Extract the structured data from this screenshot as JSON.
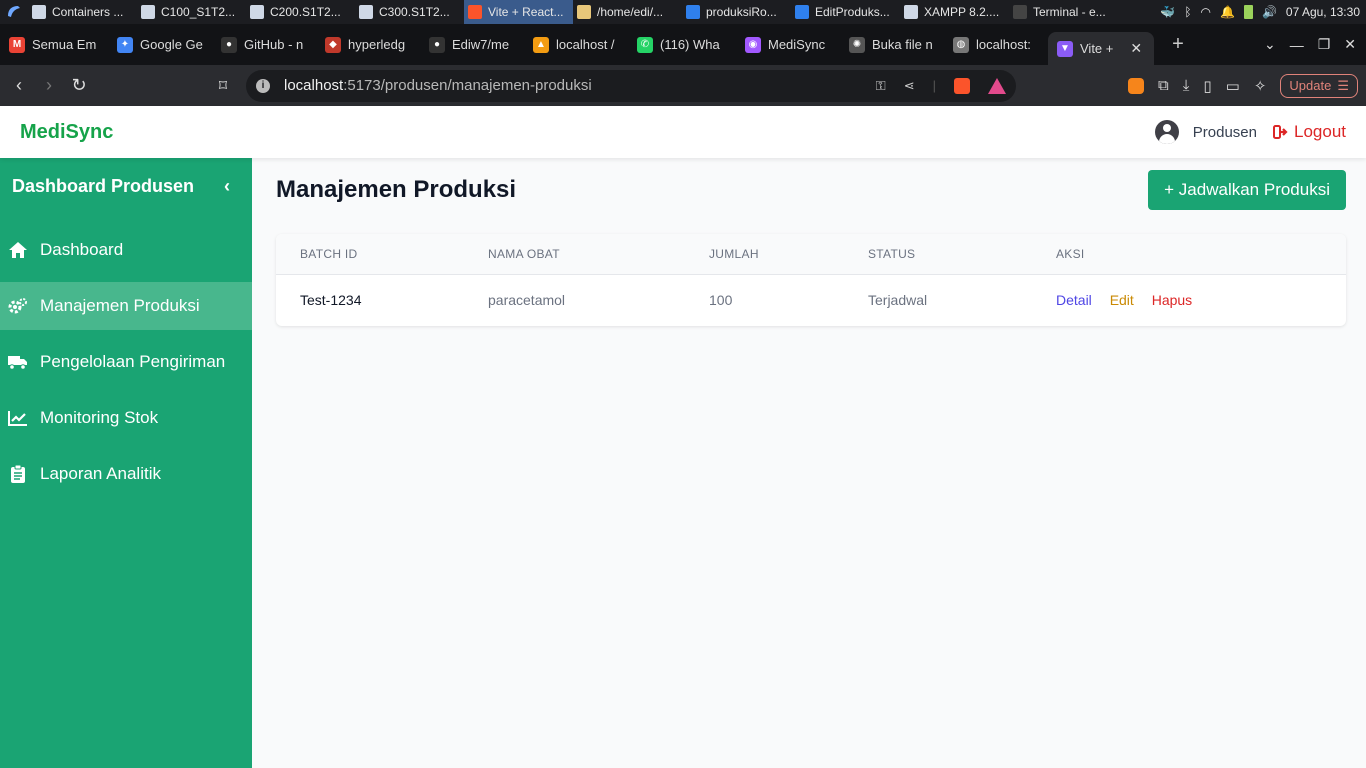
{
  "taskbar": {
    "tasks": [
      {
        "label": "Containers ...",
        "icon": "window-icon",
        "color": "#cfd8e6"
      },
      {
        "label": "C100_S1T2...",
        "icon": "document-icon",
        "color": "#cfd8e6"
      },
      {
        "label": "C200.S1T2...",
        "icon": "document-icon",
        "color": "#cfd8e6"
      },
      {
        "label": "C300.S1T2...",
        "icon": "document-icon",
        "color": "#cfd8e6"
      },
      {
        "label": "Vite + React...",
        "icon": "brave-icon",
        "color": "#fb542b"
      },
      {
        "label": "/home/edi/...",
        "icon": "folder-icon",
        "color": "#e8c77a"
      },
      {
        "label": "produksiRo...",
        "icon": "vscode-icon",
        "color": "#2f80ed"
      },
      {
        "label": "EditProduks...",
        "icon": "vscode-icon",
        "color": "#2f80ed"
      },
      {
        "label": "XAMPP 8.2....",
        "icon": "window-icon",
        "color": "#cfd8e6"
      },
      {
        "label": "Terminal - e...",
        "icon": "terminal-icon",
        "color": "#444444"
      }
    ],
    "clock": "07 Agu, 13:30"
  },
  "browser_tabs": [
    {
      "label": "Semua Em",
      "favicon": "gmail-icon",
      "color": "#ea4335",
      "glyph": "M"
    },
    {
      "label": "Google Ge",
      "favicon": "gemini-icon",
      "color": "#4285f4",
      "glyph": "✦"
    },
    {
      "label": "GitHub - n",
      "favicon": "github-icon",
      "color": "#333333",
      "glyph": "●"
    },
    {
      "label": "hyperledg",
      "favicon": "shield-icon",
      "color": "#c0392b",
      "glyph": "◆"
    },
    {
      "label": "Ediw7/me",
      "favicon": "github-icon",
      "color": "#333333",
      "glyph": "●"
    },
    {
      "label": "localhost /",
      "favicon": "phpmyadmin-icon",
      "color": "#f39c12",
      "glyph": "▲"
    },
    {
      "label": "(116) Wha",
      "favicon": "whatsapp-icon",
      "color": "#25d366",
      "glyph": "✆"
    },
    {
      "label": "MediSync",
      "favicon": "figma-icon",
      "color": "#a259ff",
      "glyph": "◉"
    },
    {
      "label": "Buka file n",
      "favicon": "openai-icon",
      "color": "#555555",
      "glyph": "✺"
    },
    {
      "label": "localhost:",
      "favicon": "globe-icon",
      "color": "#777777",
      "glyph": "◍"
    },
    {
      "label": "Vite +",
      "favicon": "vite-icon",
      "color": "#8b5cf6",
      "glyph": "▼"
    }
  ],
  "address": {
    "host": "localhost",
    "path": ":5173/produsen/manajemen-produksi",
    "update_label": "Update"
  },
  "app": {
    "brand": "MediSync",
    "user_label": "Produsen",
    "logout_label": "Logout",
    "accent": "#1aa473"
  },
  "sidebar": {
    "title": "Dashboard Produsen",
    "items": [
      {
        "label": "Dashboard",
        "icon": "home-icon",
        "active": false
      },
      {
        "label": "Manajemen Produksi",
        "icon": "cogs-icon",
        "active": true
      },
      {
        "label": "Pengelolaan Pengiriman",
        "icon": "truck-icon",
        "active": false
      },
      {
        "label": "Monitoring Stok",
        "icon": "chart-line-icon",
        "active": false
      },
      {
        "label": "Laporan Analitik",
        "icon": "clipboard-icon",
        "active": false
      }
    ]
  },
  "main": {
    "title": "Manajemen Produksi",
    "add_button": "+ Jadwalkan Produksi",
    "table": {
      "headers": [
        "BATCH ID",
        "NAMA OBAT",
        "JUMLAH",
        "STATUS",
        "AKSI"
      ],
      "rows": [
        {
          "batch": "Test-1234",
          "drug": "paracetamol",
          "qty": "100",
          "status": "Terjadwal",
          "actions": {
            "detail": "Detail",
            "edit": "Edit",
            "delete": "Hapus"
          }
        }
      ]
    }
  }
}
